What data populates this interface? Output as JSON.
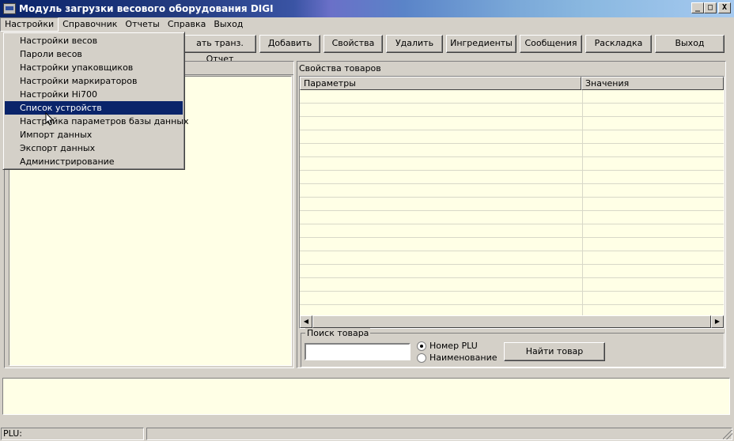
{
  "window": {
    "title": "Модуль загрузки весового оборудования DIGI",
    "min": "_",
    "max": "□",
    "close": "X"
  },
  "menubar": [
    "Настройки",
    "Справочник",
    "Отчеты",
    "Справка",
    "Выход"
  ],
  "settings_menu": {
    "items": [
      "Настройки весов",
      "Пароли весов",
      "Настройки упаковщиков",
      "Настройки маркираторов",
      "Настройки Hi700",
      "Список устройств",
      "Настройка параметров базы данных",
      "Импорт данных",
      "Экспорт данных",
      "Администрирование"
    ],
    "selected_index": 5
  },
  "toolbar": {
    "partial_button": "ать транз. Отчет",
    "buttons": [
      "Добавить",
      "Свойства",
      "Удалить",
      "Ингредиенты",
      "Сообщения",
      "Раскладка",
      "Выход"
    ]
  },
  "properties": {
    "title": "Свойства товаров",
    "col_params": "Параметры",
    "col_values": "Значения"
  },
  "search": {
    "legend": "Поиск товара",
    "input_value": "",
    "radio_plu": "Номер PLU",
    "radio_name": "Наименование",
    "selected": "plu",
    "find_button": "Найти товар"
  },
  "status": {
    "plu": "PLU:"
  },
  "scroll": {
    "left": "◀",
    "right": "▶"
  },
  "colors": {
    "title_dark": "#0a246a",
    "panel_bg": "#ffffe6",
    "face": "#d4d0c8"
  }
}
